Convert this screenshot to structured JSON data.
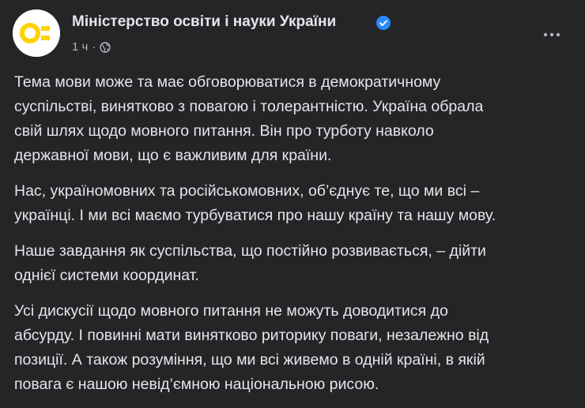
{
  "post": {
    "author": "Міністерство освіти і науки України",
    "time": "1 ч",
    "separator": "·",
    "icons": {
      "avatar": "ministry-logo",
      "verified": "verified-badge-icon",
      "audience": "globe-icon",
      "menu": "more-options-icon"
    },
    "colors": {
      "logo_yellow": "#ffd200",
      "verified_blue": "#2d88ff",
      "background": "#242526"
    },
    "paragraphs": [
      "Тема мови може та має обговорюватися в демократичному\nсуспільстві, винятково з повагою і толерантністю. Україна обрала\nсвій шлях щодо мовного питання. Він про турботу навколо\nдержавної мови, що є важливим для країни.",
      "Нас, україномовних та російськомовних, об’єднує те, що ми всі –\nукраїнці. І ми всі маємо турбуватися про нашу країну та нашу мову.",
      "Наше завдання як суспільства, що постійно розвивається, – дійти\nоднієї системи координат.",
      "Усі дискусії щодо мовного питання не можуть доводитися до\nабсурду. І повинні мати винятково риторику поваги, незалежно від\nпозиції. А також розуміння, що ми всі живемо в одній країні, в якій\nповага є нашою невід’ємною національною рисою."
    ]
  }
}
